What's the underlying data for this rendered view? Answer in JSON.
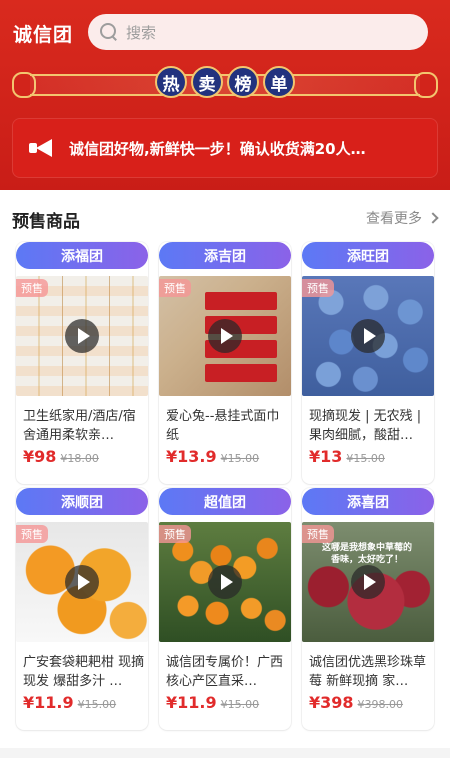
{
  "header": {
    "brand": "诚信团",
    "search_placeholder": "搜索"
  },
  "banner": {
    "title": [
      "热",
      "卖",
      "榜",
      "单"
    ]
  },
  "notice": {
    "text": "诚信团好物,新鲜快一步！确认收货满20人…"
  },
  "section": {
    "title": "预售商品",
    "see_more": "查看更多"
  },
  "badge_text": "预售",
  "products": [
    {
      "group": "添福团",
      "name": "卫生纸家用/酒店/宿舍通用柔软亲…",
      "price": "¥98",
      "old_price": "¥18.00"
    },
    {
      "group": "添吉团",
      "name": "爱心兔--悬挂式面巾纸",
      "price": "¥13.9",
      "old_price": "¥15.00"
    },
    {
      "group": "添旺团",
      "name": "现摘现发 | 无农残 | 果肉细腻，酸甜…",
      "price": "¥13",
      "old_price": "¥15.00"
    },
    {
      "group": "添顺团",
      "name": "广安套袋耙耙柑 现摘现发 爆甜多汁 …",
      "price": "¥11.9",
      "old_price": "¥15.00"
    },
    {
      "group": "超值团",
      "name": "诚信团专属价！广西核心产区直采…",
      "price": "¥11.9",
      "old_price": "¥15.00"
    },
    {
      "group": "添喜团",
      "name": "诚信团优选黑珍珠草莓 新鲜现摘 家…",
      "price": "¥398",
      "old_price": "¥398.00"
    }
  ],
  "image_text": {
    "strawberry_caption": "这哪是我想象中草莓的香味，太好吃了！"
  },
  "colors": {
    "hero_red": "#d92a1e",
    "accent_blue": "#5c79f5",
    "price_red": "#e12b2b"
  },
  "icons": {
    "search": "search-icon",
    "megaphone": "megaphone-icon",
    "play": "play-icon",
    "chevron": "chevron-right-icon"
  }
}
